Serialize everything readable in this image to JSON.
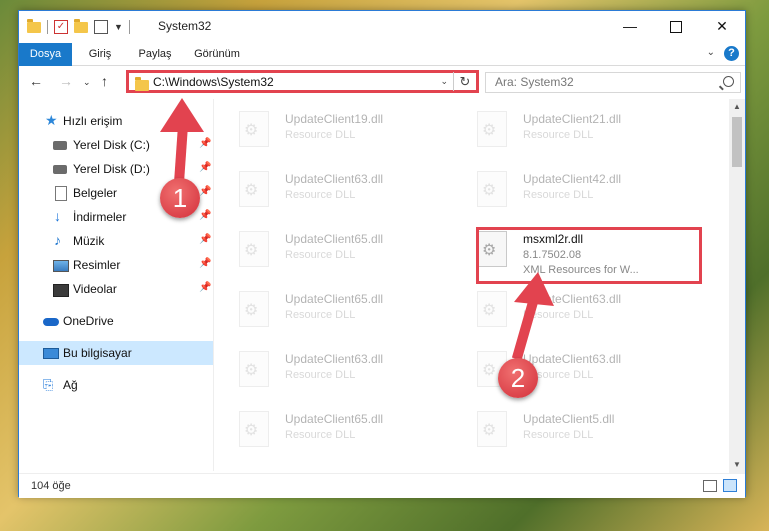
{
  "window": {
    "title": "System32"
  },
  "ribbon": {
    "tabs": [
      "Dosya",
      "Giriş",
      "Paylaş",
      "Görünüm"
    ]
  },
  "address": {
    "path": "C:\\Windows\\System32",
    "search_placeholder": "Ara: System32"
  },
  "nav": {
    "items": [
      {
        "label": "Hızlı erişim",
        "icon": "star-icon"
      },
      {
        "label": "Yerel Disk (C:)",
        "icon": "disk-icon"
      },
      {
        "label": "Yerel Disk (D:)",
        "icon": "disk-icon"
      },
      {
        "label": "Belgeler",
        "icon": "document-icon"
      },
      {
        "label": "İndirmeler",
        "icon": "download-icon"
      },
      {
        "label": "Müzik",
        "icon": "music-icon"
      },
      {
        "label": "Resimler",
        "icon": "pictures-icon"
      },
      {
        "label": "Videolar",
        "icon": "videos-icon"
      },
      {
        "label": "OneDrive",
        "icon": "cloud-icon"
      },
      {
        "label": "Bu bilgisayar",
        "icon": "computer-icon"
      },
      {
        "label": "Ağ",
        "icon": "network-icon"
      }
    ]
  },
  "files": [
    {
      "name": "UpdateClient19.dll",
      "type": "Resource DLL"
    },
    {
      "name": "UpdateClient21.dll",
      "type": "Resource DLL"
    },
    {
      "name": "UpdateClient63.dll",
      "type": "Resource DLL"
    },
    {
      "name": "UpdateClient42.dll",
      "type": "Resource DLL"
    },
    {
      "name": "UpdateClient65.dll",
      "type": "Resource DLL"
    },
    {
      "name": "msxml2r.dll",
      "type": "8.1.7502.08",
      "extra": "XML Resources for W..."
    },
    {
      "name": "UpdateClient65.dll",
      "type": "Resource DLL"
    },
    {
      "name": "UpdateClient63.dll",
      "type": "Resource DLL"
    },
    {
      "name": "UpdateClient63.dll",
      "type": "Resource DLL"
    },
    {
      "name": "UpdateClient63.dll",
      "type": "Resource DLL"
    },
    {
      "name": "UpdateClient65.dll",
      "type": "Resource DLL"
    },
    {
      "name": "UpdateClient5.dll",
      "type": "Resource DLL"
    }
  ],
  "status": {
    "count": "104 öğe"
  },
  "annotations": {
    "step1": "1",
    "step2": "2",
    "color": "#e2434f"
  }
}
